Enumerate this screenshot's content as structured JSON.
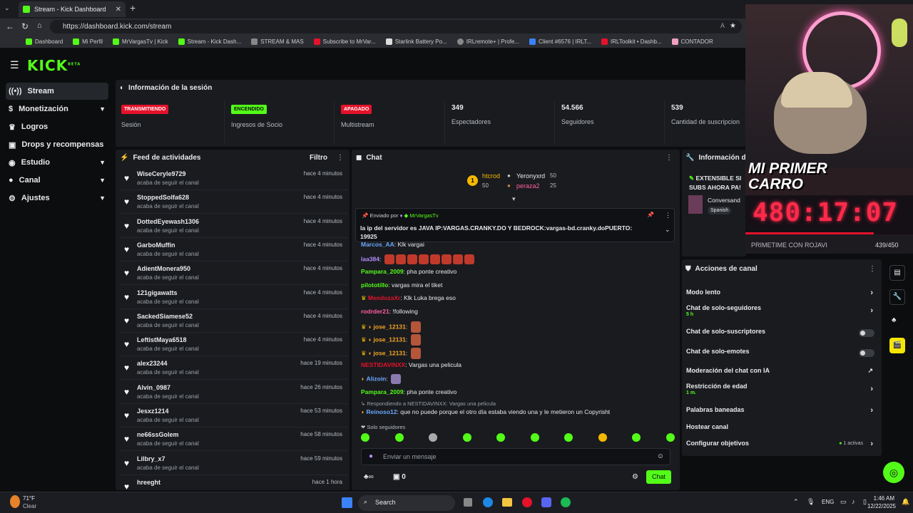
{
  "browser": {
    "tab_title": "Stream - Kick Dashboard",
    "url": "https://dashboard.kick.com/stream",
    "bookmarks": [
      "Dashboard",
      "Mi Perfil",
      "MrVargasTv | Kick",
      "Stream - Kick Dash...",
      "STREAM & MAS",
      "Subscribe to MrVar...",
      "Starlink Battery Po...",
      "IRLremote+ | Profe...",
      "Client #6576 | IRLT...",
      "IRLToolkit • Dashb...",
      "CONTADOR"
    ]
  },
  "brand": {
    "logo": "KICK",
    "beta": "BETA",
    "accent": "#53fc18"
  },
  "sidebar": {
    "items": [
      {
        "label": "Stream",
        "active": true,
        "icon": "broadcast-icon"
      },
      {
        "label": "Monetización",
        "icon": "dollar-icon"
      },
      {
        "label": "Logros",
        "icon": "trophy-icon"
      },
      {
        "label": "Drops y recompensas",
        "icon": "gift-icon"
      },
      {
        "label": "Estudio",
        "icon": "studio-icon"
      },
      {
        "label": "Canal",
        "icon": "person-icon"
      },
      {
        "label": "Ajustes",
        "icon": "gear-icon"
      }
    ]
  },
  "session": {
    "title": "Información de la sesión",
    "cells": [
      {
        "badge": "TRANSMITIENDO",
        "badge_color": "#e5122a",
        "label": "Sesión"
      },
      {
        "badge": "ENCENDIDO",
        "badge_color": "#53fc18",
        "label": "Ingresos de Socio"
      },
      {
        "badge": "APAGADO",
        "badge_color": "#e5122a",
        "label": "Multistream"
      },
      {
        "value": "349",
        "label": "Espectadores"
      },
      {
        "value": "54.566",
        "label": "Seguidores"
      },
      {
        "value": "539",
        "label": "Cantidad de suscripcion"
      }
    ]
  },
  "activity": {
    "title": "Feed de actividades",
    "filter": "Filtro",
    "rows": [
      {
        "name": "WiseCeryle9729",
        "sub": "acaba de seguir el canal",
        "time": "hace 4 minutos"
      },
      {
        "name": "StoppedSolfa628",
        "sub": "acaba de seguir el canal",
        "time": "hace 4 minutos"
      },
      {
        "name": "DottedEyewash1306",
        "sub": "acaba de seguir el canal",
        "time": "hace 4 minutos"
      },
      {
        "name": "GarboMuffin",
        "sub": "acaba de seguir el canal",
        "time": "hace 4 minutos"
      },
      {
        "name": "AdientMonera950",
        "sub": "acaba de seguir el canal",
        "time": "hace 4 minutos"
      },
      {
        "name": "121gigawatts",
        "sub": "acaba de seguir el canal",
        "time": "hace 4 minutos"
      },
      {
        "name": "SackedSiamese52",
        "sub": "acaba de seguir el canal",
        "time": "hace 4 minutos"
      },
      {
        "name": "LeftistMaya6518",
        "sub": "acaba de seguir el canal",
        "time": "hace 4 minutos"
      },
      {
        "name": "alex23244",
        "sub": "acaba de seguir el canal",
        "time": "hace 19 minutos"
      },
      {
        "name": "Alvin_0987",
        "sub": "acaba de seguir el canal",
        "time": "hace 26 minutos"
      },
      {
        "name": "Jesxz1214",
        "sub": "acaba de seguir el canal",
        "time": "hace 53 minutos"
      },
      {
        "name": "ne66ssGolem",
        "sub": "acaba de seguir el canal",
        "time": "hace 58 minutos"
      },
      {
        "name": "Lilbry_x7",
        "sub": "acaba de seguir el canal",
        "time": "hace 59 minutos"
      },
      {
        "name": "hreeght",
        "sub": "",
        "time": "hace 1 hora"
      }
    ]
  },
  "chat": {
    "title": "Chat",
    "top": {
      "first": "htcrod",
      "first_pts": "50",
      "second": "Yeronyxrd",
      "second_pts": "50",
      "third": "peraza2",
      "third_pts": "25",
      "rank": "1"
    },
    "pinned": {
      "sent_by": "Enviado por",
      "user": "MrVargasTv",
      "text": "la ip del servidor es JAVA IP:VARGAS.CRANKY.DO Y BEDROCK:vargas-bd.cranky.doPUERTO: 19925"
    },
    "messages": [
      {
        "user": "Marcos_AA",
        "color": "#6aa8ff",
        "text": "Klk vargai"
      },
      {
        "user": "laa384",
        "color": "#b68cff",
        "text": ""
      },
      {
        "user": "Pampara_2009",
        "color": "#53fc18",
        "text": "pha ponte creativo"
      },
      {
        "user": "pilototillo",
        "color": "#53fc18",
        "text": "vargas mira el tiket"
      },
      {
        "user": "MendozaXr",
        "color": "#e5122a",
        "text": "Klk Luka brega eso"
      },
      {
        "user": "rodrder21",
        "color": "#ff5fa0",
        "text": "!following"
      },
      {
        "user": "jose_12131",
        "color": "#f5a623",
        "text": ""
      },
      {
        "user": "jose_12131",
        "color": "#f5a623",
        "text": ""
      },
      {
        "user": "jose_12131",
        "color": "#f5a623",
        "text": ""
      },
      {
        "user": "NESTIDAVINXX",
        "color": "#e5122a",
        "text": "Vargas una pelicula"
      },
      {
        "user": "Alizoin",
        "color": "#6aa8ff",
        "text": ""
      },
      {
        "user": "Pampara_2009",
        "color": "#53fc18",
        "text": "pha ponte creativo"
      }
    ],
    "reply_context": "Respondiendo a NESTIDAVINXX: Vargas una pelicula",
    "reply": {
      "user": "Reinoso12",
      "text": "que no puede porque el otro día estaba viendo una y le metieron un Copyrisht"
    },
    "followers_only": "Solo seguidores",
    "input_placeholder": "Enviar un mensaje",
    "count": "0",
    "send": "Chat"
  },
  "stream_info": {
    "title": "Información del",
    "headline": "EXTENSIBLE SI",
    "sub": "SUBS AHORA PA!",
    "conv": "Conversand",
    "lang": "Spanish"
  },
  "overlay": {
    "caption": "MI PRIMER CARRO",
    "timer": "480:17:07",
    "label": "PRIMETIME CON ROJAVI",
    "counter": "439/450"
  },
  "actions": {
    "title": "Acciones de canal",
    "rows": [
      {
        "label": "Modo lento",
        "kind": "chevron"
      },
      {
        "label": "Chat de solo-seguidores",
        "sub": "5 h",
        "kind": "chevron"
      },
      {
        "label": "Chat de solo-suscriptores",
        "kind": "toggle"
      },
      {
        "label": "Chat de solo-emotes",
        "kind": "toggle"
      },
      {
        "label": "Moderación del chat con IA",
        "kind": "external"
      },
      {
        "label": "Restricción de edad",
        "sub": "1 m.",
        "kind": "chevron"
      },
      {
        "label": "Palabras baneadas",
        "kind": "chevron"
      },
      {
        "label": "Hostear canal",
        "kind": "none"
      },
      {
        "label": "Configurar objetivos",
        "kind": "chevron",
        "extra": "1 activas"
      }
    ]
  },
  "taskbar": {
    "weather_temp": "71°F",
    "weather_desc": "Clear",
    "search": "Search",
    "lang": "ENG",
    "time": "1:46 AM",
    "date": "12/22/2025"
  }
}
